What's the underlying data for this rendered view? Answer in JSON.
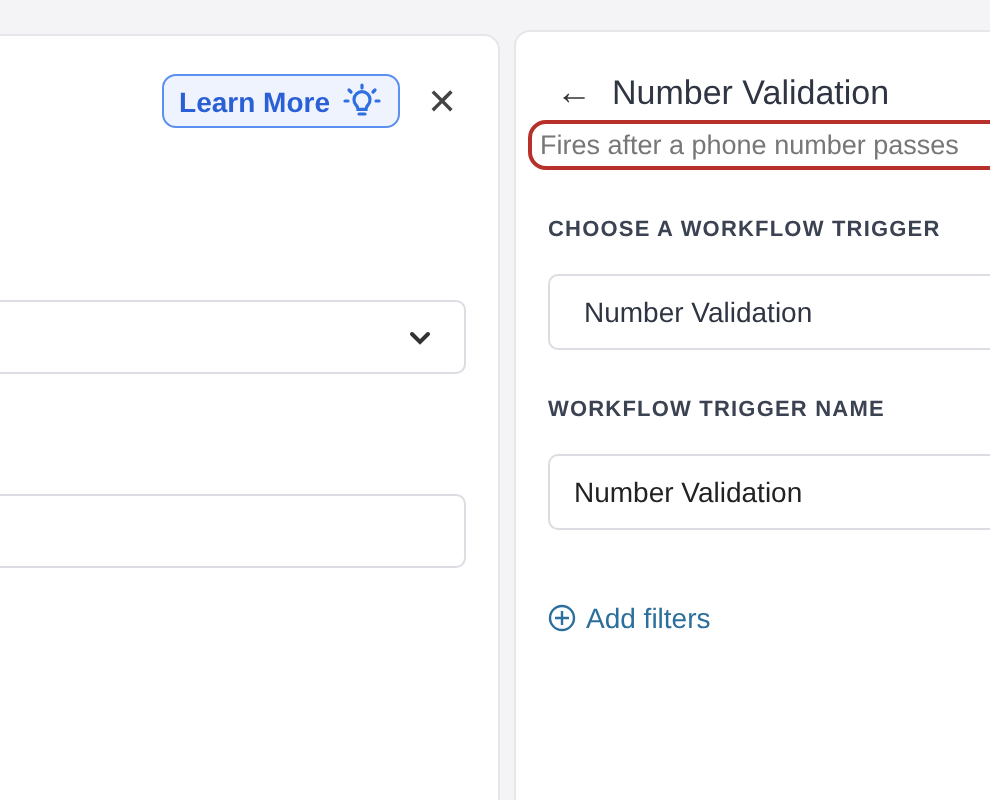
{
  "left_panel": {
    "learn_more_button": "Learn More",
    "close_button": "✕",
    "select": {
      "expanded": false
    }
  },
  "right_panel": {
    "back_button": "←",
    "title": "Number Validation",
    "subtitle": {
      "text": "Fires after a phone number passes",
      "highlighted": true
    },
    "fields": [
      {
        "label": "CHOOSE A WORKFLOW TRIGGER",
        "value": "Number Validation",
        "kind": "select"
      },
      {
        "label": "WORKFLOW TRIGGER NAME",
        "value": "Number Validation",
        "kind": "input"
      }
    ],
    "add_filters": "Add filters"
  }
}
